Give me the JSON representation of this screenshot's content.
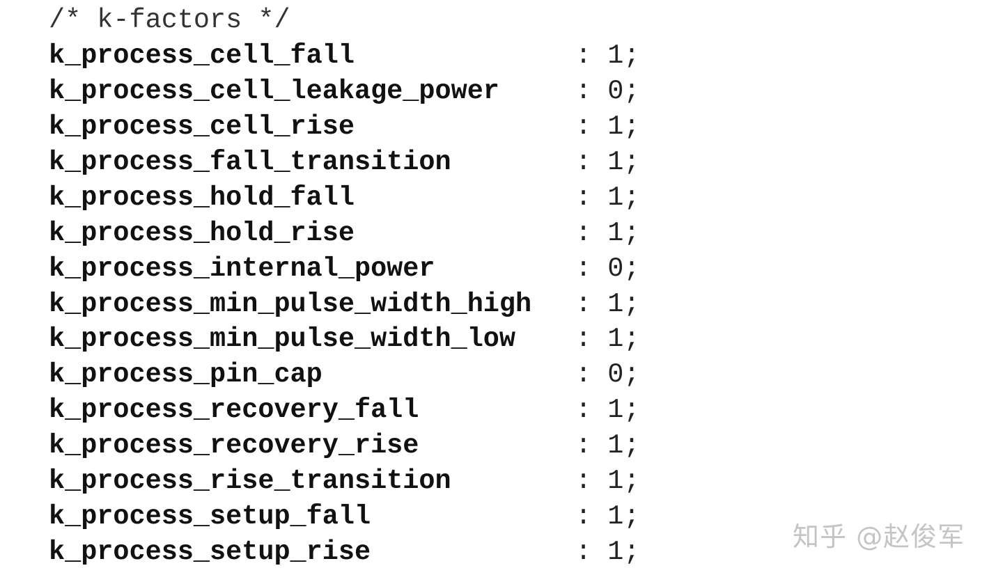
{
  "comment": "/* k-factors */",
  "separator": ":",
  "terminator": ";",
  "entries": [
    {
      "key": "k_process_cell_fall",
      "value": "1"
    },
    {
      "key": "k_process_cell_leakage_power",
      "value": "0"
    },
    {
      "key": "k_process_cell_rise",
      "value": "1"
    },
    {
      "key": "k_process_fall_transition",
      "value": "1"
    },
    {
      "key": "k_process_hold_fall",
      "value": "1"
    },
    {
      "key": "k_process_hold_rise",
      "value": "1"
    },
    {
      "key": "k_process_internal_power",
      "value": "0"
    },
    {
      "key": "k_process_min_pulse_width_high",
      "value": "1"
    },
    {
      "key": "k_process_min_pulse_width_low",
      "value": "1"
    },
    {
      "key": "k_process_pin_cap",
      "value": "0"
    },
    {
      "key": "k_process_recovery_fall",
      "value": "1"
    },
    {
      "key": "k_process_recovery_rise",
      "value": "1"
    },
    {
      "key": "k_process_rise_transition",
      "value": "1"
    },
    {
      "key": "k_process_setup_fall",
      "value": "1"
    },
    {
      "key": "k_process_setup_rise",
      "value": "1"
    }
  ],
  "watermark": "知乎 @赵俊军"
}
